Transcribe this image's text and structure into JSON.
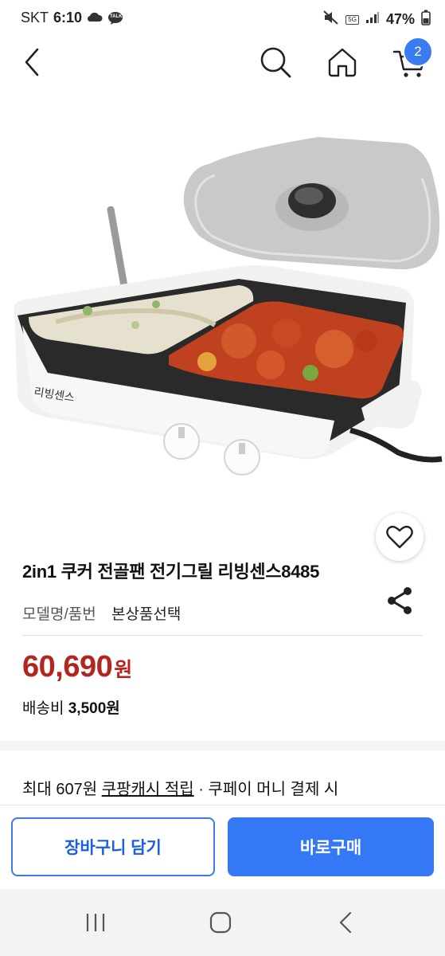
{
  "status_bar": {
    "carrier": "SKT",
    "time": "6:10",
    "talk_badge": "TALK",
    "network": "5G",
    "battery": "47%"
  },
  "header": {
    "cart_count": "2",
    "icons": [
      "back-icon",
      "search-icon",
      "home-icon",
      "cart-icon"
    ]
  },
  "product": {
    "image_brand": "리빙센스",
    "title": "2in1 쿠커 전골팬 전기그릴 리빙센스8485",
    "model_label": "모델명/품번",
    "model_value": "본상품선택",
    "price": "60,690",
    "price_unit": "원",
    "shipping_label": "배송비",
    "shipping_amount": "3,500원"
  },
  "cashback": {
    "prefix": "최대 607원 ",
    "link": "쿠팡캐시 적립",
    "suffix": " · 쿠페이 머니 결제 시"
  },
  "actions": {
    "add_to_cart": "장바구니 담기",
    "buy_now": "바로구매"
  },
  "colors": {
    "accent_blue": "#3578f6",
    "price_red": "#b3261e",
    "nav_bg": "#f3f3f5"
  }
}
